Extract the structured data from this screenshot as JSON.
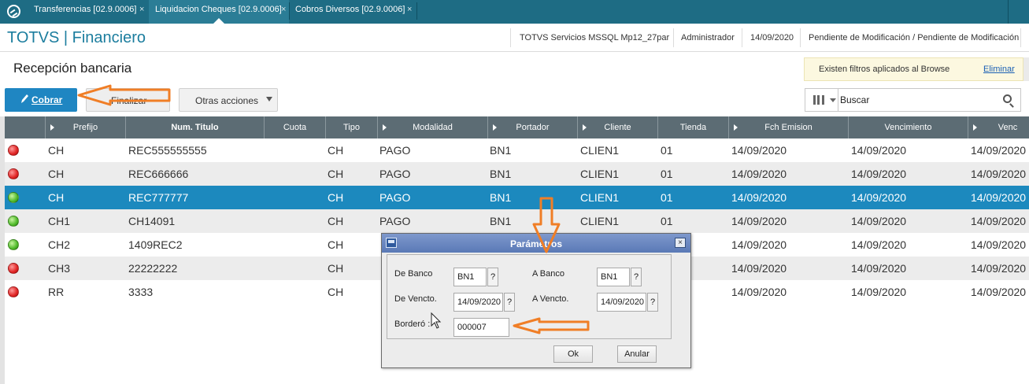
{
  "tabs": [
    {
      "label": "Transferencias [02.9.0006]",
      "close": "×"
    },
    {
      "label": "Liquidacion Cheques [02.9.0006]",
      "close": "×"
    },
    {
      "label": "Cobros Diversos [02.9.0006]",
      "close": "×"
    }
  ],
  "header": {
    "app_title": "TOTVS | Financiero",
    "environment": "TOTVS Servicios MSSQL Mp12_27par",
    "user": "Administrador",
    "date": "14/09/2020",
    "status": "Pendiente de Modificación / Pendiente de Modificación"
  },
  "page": {
    "title": "Recepción bancaria"
  },
  "filter_notice": {
    "text": "Existen filtros aplicados al Browse",
    "remove_link": "Eliminar"
  },
  "toolbar": {
    "cobrar": "Cobrar",
    "finalizar": "Finalizar",
    "otras": "Otras acciones"
  },
  "search": {
    "placeholder": "Buscar"
  },
  "table": {
    "columns": [
      "Prefijo",
      "Num. Titulo",
      "Cuota",
      "Tipo",
      "Modalidad",
      "Portador",
      "Cliente",
      "Tienda",
      "Fch Emision",
      "Vencimiento",
      "Venc"
    ],
    "rows": [
      {
        "status": "red",
        "prefijo": "CH",
        "num": "REC555555555",
        "cuota": "",
        "tipo": "CH",
        "modalidad": "PAGO",
        "portador": "BN1",
        "cliente": "CLIEN1",
        "tienda": "01",
        "emision": "14/09/2020",
        "vencimiento": "14/09/2020",
        "venc": "14/09/2020"
      },
      {
        "status": "red",
        "prefijo": "CH",
        "num": "REC666666",
        "cuota": "",
        "tipo": "CH",
        "modalidad": "PAGO",
        "portador": "BN1",
        "cliente": "CLIEN1",
        "tienda": "01",
        "emision": "14/09/2020",
        "vencimiento": "14/09/2020",
        "venc": "14/09/2020"
      },
      {
        "status": "green",
        "prefijo": "CH",
        "num": "REC777777",
        "cuota": "",
        "tipo": "CH",
        "modalidad": "PAGO",
        "portador": "BN1",
        "cliente": "CLIEN1",
        "tienda": "01",
        "emision": "14/09/2020",
        "vencimiento": "14/09/2020",
        "venc": "14/09/2020"
      },
      {
        "status": "green",
        "prefijo": "CH1",
        "num": "CH14091",
        "cuota": "",
        "tipo": "CH",
        "modalidad": "PAGO",
        "portador": "BN1",
        "cliente": "CLIEN1",
        "tienda": "01",
        "emision": "14/09/2020",
        "vencimiento": "14/09/2020",
        "venc": "14/09/2020"
      },
      {
        "status": "green",
        "prefijo": "CH2",
        "num": "1409REC2",
        "cuota": "",
        "tipo": "CH",
        "modalidad": "",
        "portador": "",
        "cliente": "",
        "tienda": "",
        "emision": "14/09/2020",
        "vencimiento": "14/09/2020",
        "venc": "14/09/2020"
      },
      {
        "status": "red",
        "prefijo": "CH3",
        "num": "22222222",
        "cuota": "",
        "tipo": "CH",
        "modalidad": "",
        "portador": "",
        "cliente": "",
        "tienda": "",
        "emision": "14/09/2020",
        "vencimiento": "14/09/2020",
        "venc": "14/09/2020"
      },
      {
        "status": "red",
        "prefijo": "RR",
        "num": "3333",
        "cuota": "",
        "tipo": "CH",
        "modalidad": "",
        "portador": "",
        "cliente": "",
        "tienda": "",
        "emision": "14/09/2020",
        "vencimiento": "14/09/2020",
        "venc": "14/09/2020"
      }
    ]
  },
  "dialog": {
    "title": "Parámetros",
    "close": "×",
    "de_banco_label": "De Banco",
    "de_banco_value": "BN1",
    "a_banco_label": "A Banco",
    "a_banco_value": "BN1",
    "de_vencto_label": "De Vencto.",
    "de_vencto_value": "14/09/2020",
    "a_vencto_label": "A Vencto.",
    "a_vencto_value": "14/09/2020",
    "bordero_label": "Borderó :",
    "bordero_value": "000007",
    "lookup": "?",
    "ok": "Ok",
    "anular": "Anular"
  },
  "colors": {
    "tabbar": "#1e6c84",
    "accent": "#1f86c2",
    "selected_row": "#1c89be",
    "header_row": "#5c6c74",
    "annotation_arrow": "#f07e26"
  }
}
